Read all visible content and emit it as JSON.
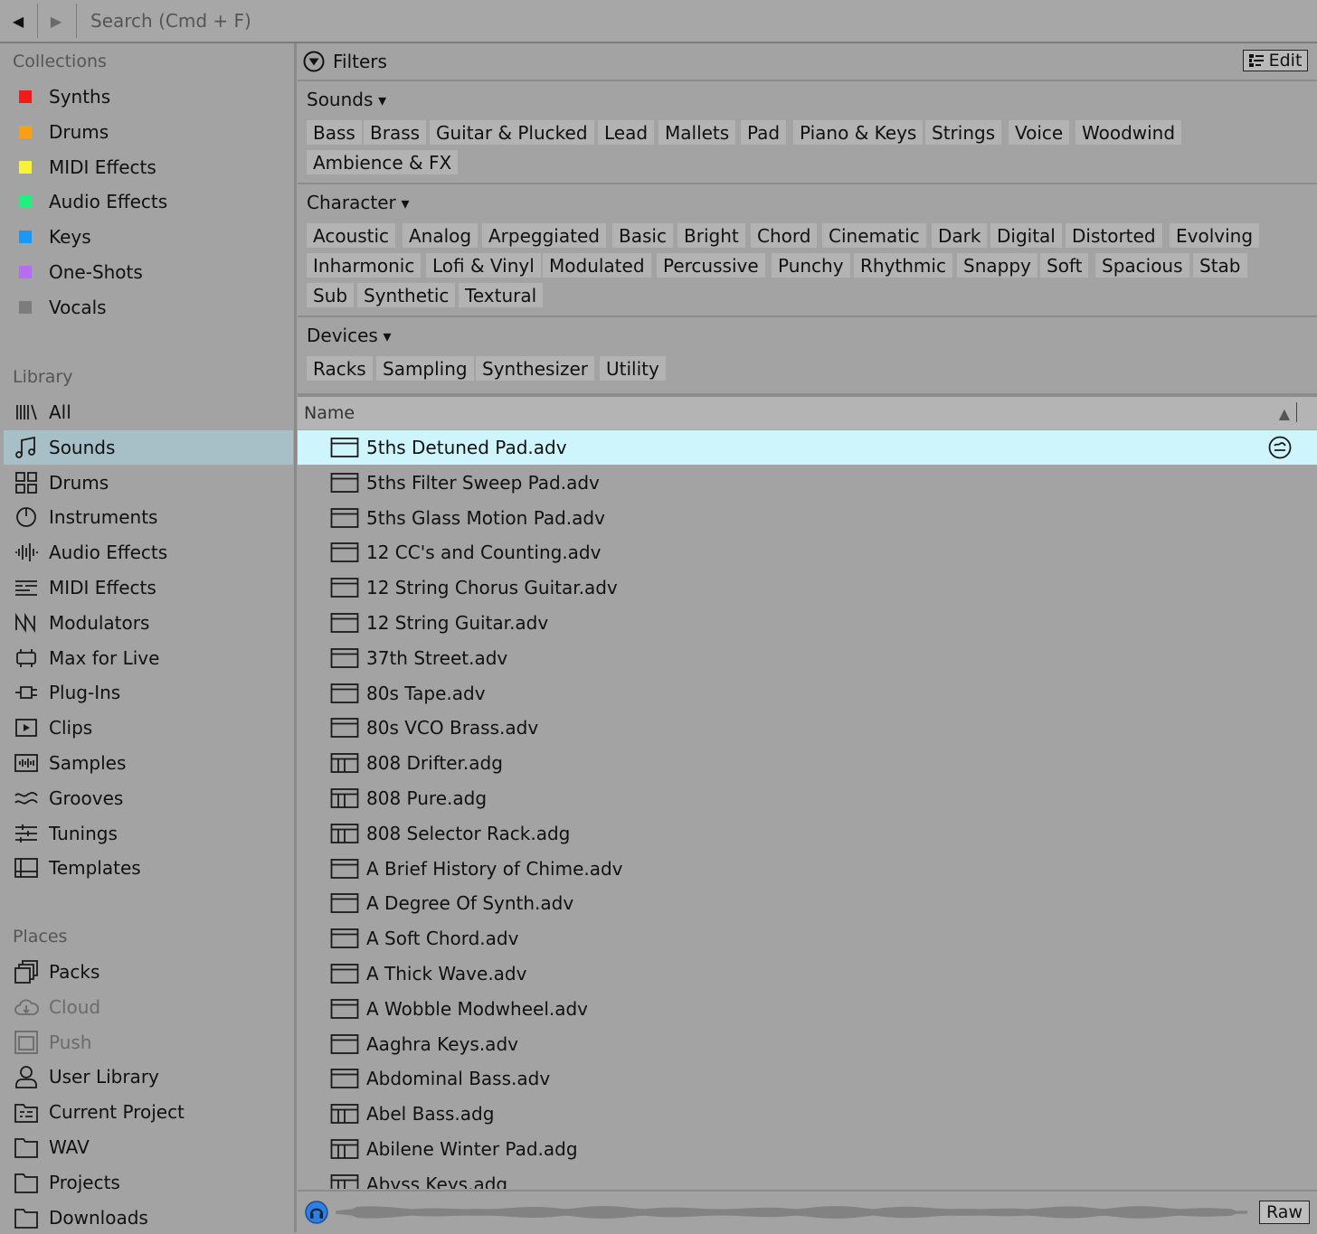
{
  "search": {
    "placeholder": "Search (Cmd + F)"
  },
  "colors": {
    "selected_sidebar": "#a7c0c8",
    "selected_row": "#cdf5fb",
    "preview_accent": "#2d7fe6"
  },
  "sidebar": {
    "collections_title": "Collections",
    "collections": [
      {
        "label": "Synths",
        "color": "#f21b1b"
      },
      {
        "label": "Drums",
        "color": "#f5a017"
      },
      {
        "label": "MIDI Effects",
        "color": "#f8f23a"
      },
      {
        "label": "Audio Effects",
        "color": "#22ef7e"
      },
      {
        "label": "Keys",
        "color": "#1b97f5"
      },
      {
        "label": "One-Shots",
        "color": "#b56ef2"
      },
      {
        "label": "Vocals",
        "color": "#7c7c7c"
      }
    ],
    "library_title": "Library",
    "library": [
      {
        "label": "All",
        "icon": "all-icon"
      },
      {
        "label": "Sounds",
        "icon": "note-icon",
        "selected": true
      },
      {
        "label": "Drums",
        "icon": "drum-pads-icon"
      },
      {
        "label": "Instruments",
        "icon": "instrument-dial-icon"
      },
      {
        "label": "Audio Effects",
        "icon": "waveform-icon"
      },
      {
        "label": "MIDI Effects",
        "icon": "midi-lines-icon"
      },
      {
        "label": "Modulators",
        "icon": "modulator-icon"
      },
      {
        "label": "Max for Live",
        "icon": "max-for-live-icon"
      },
      {
        "label": "Plug-Ins",
        "icon": "plug-icon"
      },
      {
        "label": "Clips",
        "icon": "clip-play-icon"
      },
      {
        "label": "Samples",
        "icon": "sample-icon"
      },
      {
        "label": "Grooves",
        "icon": "groove-icon"
      },
      {
        "label": "Tunings",
        "icon": "tuning-icon"
      },
      {
        "label": "Templates",
        "icon": "template-icon"
      }
    ],
    "places_title": "Places",
    "places": [
      {
        "label": "Packs",
        "icon": "packs-icon"
      },
      {
        "label": "Cloud",
        "icon": "cloud-icon",
        "dim": true
      },
      {
        "label": "Push",
        "icon": "push-icon",
        "dim": true
      },
      {
        "label": "User Library",
        "icon": "user-icon"
      },
      {
        "label": "Current Project",
        "icon": "project-folder-icon"
      },
      {
        "label": "WAV",
        "icon": "folder-icon"
      },
      {
        "label": "Projects",
        "icon": "folder-icon"
      },
      {
        "label": "Downloads",
        "icon": "folder-icon"
      }
    ]
  },
  "filters": {
    "title": "Filters",
    "edit_label": "Edit",
    "groups": [
      {
        "title": "Sounds",
        "rows": [
          [
            "Bass",
            "Brass",
            "Guitar & Plucked",
            "Lead",
            "Mallets",
            "Pad",
            "Piano & Keys",
            "Strings",
            "Voice",
            "Woodwind"
          ],
          [
            "Ambience & FX"
          ]
        ]
      },
      {
        "title": "Character",
        "rows": [
          [
            "Acoustic",
            "Analog",
            "Arpeggiated",
            "Basic",
            "Bright",
            "Chord",
            "Cinematic",
            "Dark",
            "Digital",
            "Distorted",
            "Evolving"
          ],
          [
            "Inharmonic",
            "Lofi & Vinyl",
            "Modulated",
            "Percussive",
            "Punchy",
            "Rhythmic",
            "Snappy",
            "Soft",
            "Spacious",
            "Stab"
          ],
          [
            "Sub",
            "Synthetic",
            "Textural"
          ]
        ]
      },
      {
        "title": "Devices",
        "rows": [
          [
            "Racks",
            "Sampling",
            "Synthesizer",
            "Utility"
          ]
        ]
      }
    ]
  },
  "list": {
    "column_name": "Name",
    "files": [
      {
        "name": "5ths Detuned Pad.adv",
        "type": "adv",
        "selected": true
      },
      {
        "name": "5ths Filter Sweep Pad.adv",
        "type": "adv"
      },
      {
        "name": "5ths Glass Motion Pad.adv",
        "type": "adv"
      },
      {
        "name": "12 CC's and Counting.adv",
        "type": "adv"
      },
      {
        "name": "12 String Chorus Guitar.adv",
        "type": "adv"
      },
      {
        "name": "12 String Guitar.adv",
        "type": "adv"
      },
      {
        "name": "37th Street.adv",
        "type": "adv"
      },
      {
        "name": "80s Tape.adv",
        "type": "adv"
      },
      {
        "name": "80s VCO Brass.adv",
        "type": "adv"
      },
      {
        "name": "808 Drifter.adg",
        "type": "adg"
      },
      {
        "name": "808 Pure.adg",
        "type": "adg"
      },
      {
        "name": "808 Selector Rack.adg",
        "type": "adg"
      },
      {
        "name": "A Brief History of Chime.adv",
        "type": "adv"
      },
      {
        "name": "A Degree Of Synth.adv",
        "type": "adv"
      },
      {
        "name": "A Soft Chord.adv",
        "type": "adv"
      },
      {
        "name": "A Thick Wave.adv",
        "type": "adv"
      },
      {
        "name": "A Wobble Modwheel.adv",
        "type": "adv"
      },
      {
        "name": "Aaghra Keys.adv",
        "type": "adv"
      },
      {
        "name": "Abdominal Bass.adv",
        "type": "adv"
      },
      {
        "name": "Abel Bass.adg",
        "type": "adg"
      },
      {
        "name": "Abilene Winter Pad.adg",
        "type": "adg"
      },
      {
        "name": "Abyss Keys.adg",
        "type": "adg"
      }
    ]
  },
  "preview": {
    "raw_label": "Raw"
  }
}
